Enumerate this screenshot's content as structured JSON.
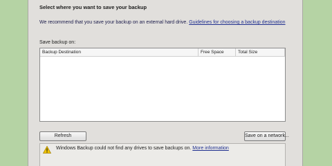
{
  "dialog": {
    "heading": "Select where you want to save your backup",
    "recommend_text": "We recommend that you save your backup on an external hard drive.",
    "guidelines_link": "Guidelines for choosing a backup destination",
    "save_on_label": "Save backup on:",
    "table": {
      "columns": [
        "Backup Destination",
        "Free Space",
        "Total Size"
      ],
      "rows": []
    },
    "refresh_button": "Refresh",
    "save_network_button": "Save on a network...",
    "warning": {
      "icon": "warning-icon",
      "text": "Windows Backup could not find any drives to save backups on.",
      "link": "More information"
    }
  }
}
